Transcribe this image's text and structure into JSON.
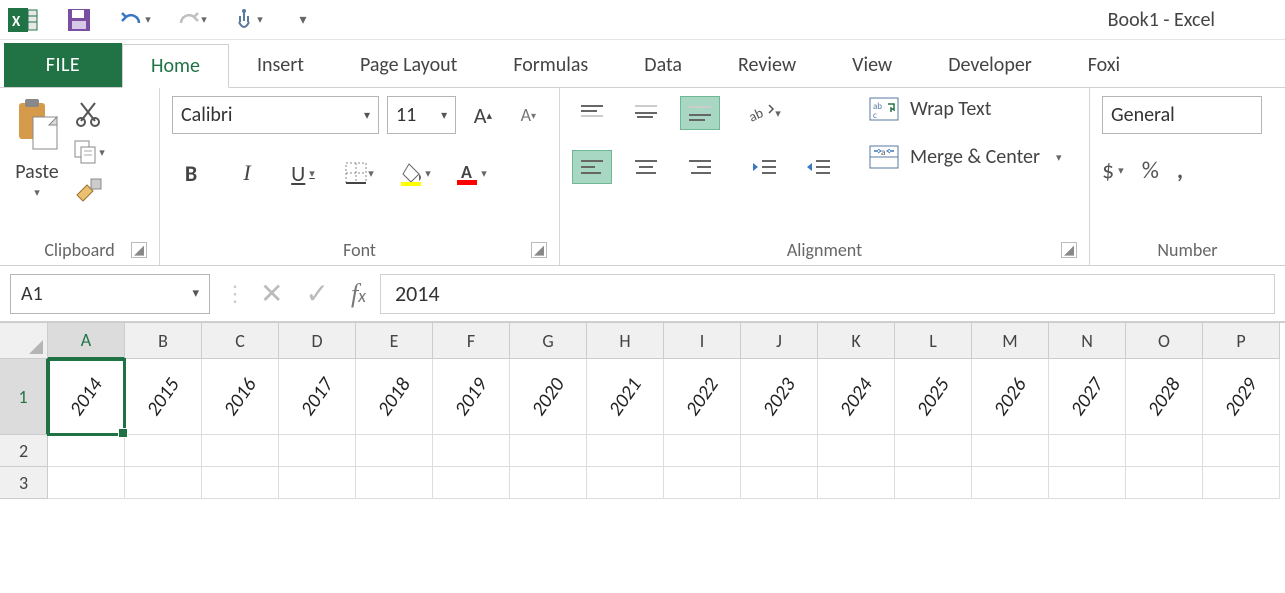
{
  "title": "Book1 - Excel",
  "tabs": {
    "file": "FILE",
    "home": "Home",
    "insert": "Insert",
    "page": "Page Layout",
    "formulas": "Formulas",
    "data": "Data",
    "review": "Review",
    "view": "View",
    "developer": "Developer",
    "foxit": "Foxi"
  },
  "clipboard": {
    "paste": "Paste",
    "label": "Clipboard"
  },
  "font": {
    "family": "Calibri",
    "size": "11",
    "bold": "B",
    "italic": "I",
    "underline": "U",
    "label": "Font"
  },
  "alignment": {
    "wrap": "Wrap Text",
    "merge": "Merge & Center",
    "label": "Alignment"
  },
  "number": {
    "format": "General",
    "label": "Number",
    "dollar": "$",
    "percent": "%",
    "comma": ","
  },
  "fbar": {
    "ref": "A1",
    "value": "2014"
  },
  "cols": [
    "A",
    "B",
    "C",
    "D",
    "E",
    "F",
    "G",
    "H",
    "I",
    "J",
    "K",
    "L",
    "M",
    "N",
    "O",
    "P"
  ],
  "row1": [
    "2014",
    "2015",
    "2016",
    "2017",
    "2018",
    "2019",
    "2020",
    "2021",
    "2022",
    "2023",
    "2024",
    "2025",
    "2026",
    "2027",
    "2028",
    "2029"
  ],
  "rows": [
    "1",
    "2",
    "3"
  ]
}
